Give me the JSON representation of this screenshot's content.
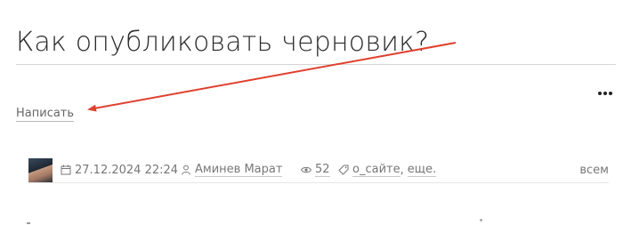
{
  "post": {
    "title": "Как опубликовать черновик?"
  },
  "actions": {
    "write_label": "Написать",
    "more_icon": "more-horizontal-icon"
  },
  "meta": {
    "date": "27.12.2024 22:24",
    "author": "Аминев Марат",
    "views": "52",
    "tag": "о_сайте",
    "tag_more": "еще.",
    "audience": "всем",
    "tag_separator": ","
  },
  "annotation": {
    "arrow_color": "#e0402f"
  }
}
